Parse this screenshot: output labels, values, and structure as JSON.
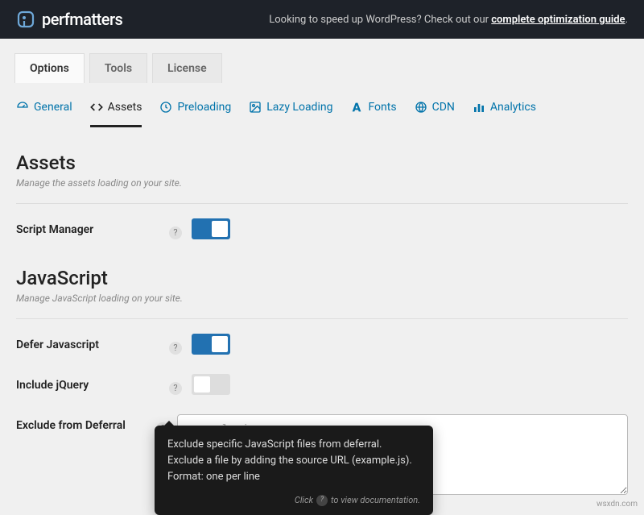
{
  "header": {
    "brand": "perfmatters",
    "promo_prefix": "Looking to speed up WordPress? Check out our ",
    "promo_link": "complete optimization guide",
    "promo_suffix": "."
  },
  "top_tabs": [
    "Options",
    "Tools",
    "License"
  ],
  "sub_tabs": [
    "General",
    "Assets",
    "Preloading",
    "Lazy Loading",
    "Fonts",
    "CDN",
    "Analytics"
  ],
  "sections": {
    "assets": {
      "title": "Assets",
      "desc": "Manage the assets loading on your site."
    },
    "javascript": {
      "title": "JavaScript",
      "desc": "Manage JavaScript loading on your site."
    }
  },
  "fields": {
    "script_manager": {
      "label": "Script Manager",
      "on": true
    },
    "defer_javascript": {
      "label": "Defer Javascript",
      "on": true
    },
    "include_jquery": {
      "label": "Include jQuery",
      "on": false
    },
    "exclude_deferral": {
      "label": "Exclude from Deferral",
      "placeholder": "example.js"
    }
  },
  "tooltip": {
    "body": "Exclude specific JavaScript files from deferral. Exclude a file by adding the source URL (example.js). Format: one per line",
    "footer_pre": "Click",
    "footer_post": "to view documentation."
  },
  "watermark": "wsxdn.com"
}
